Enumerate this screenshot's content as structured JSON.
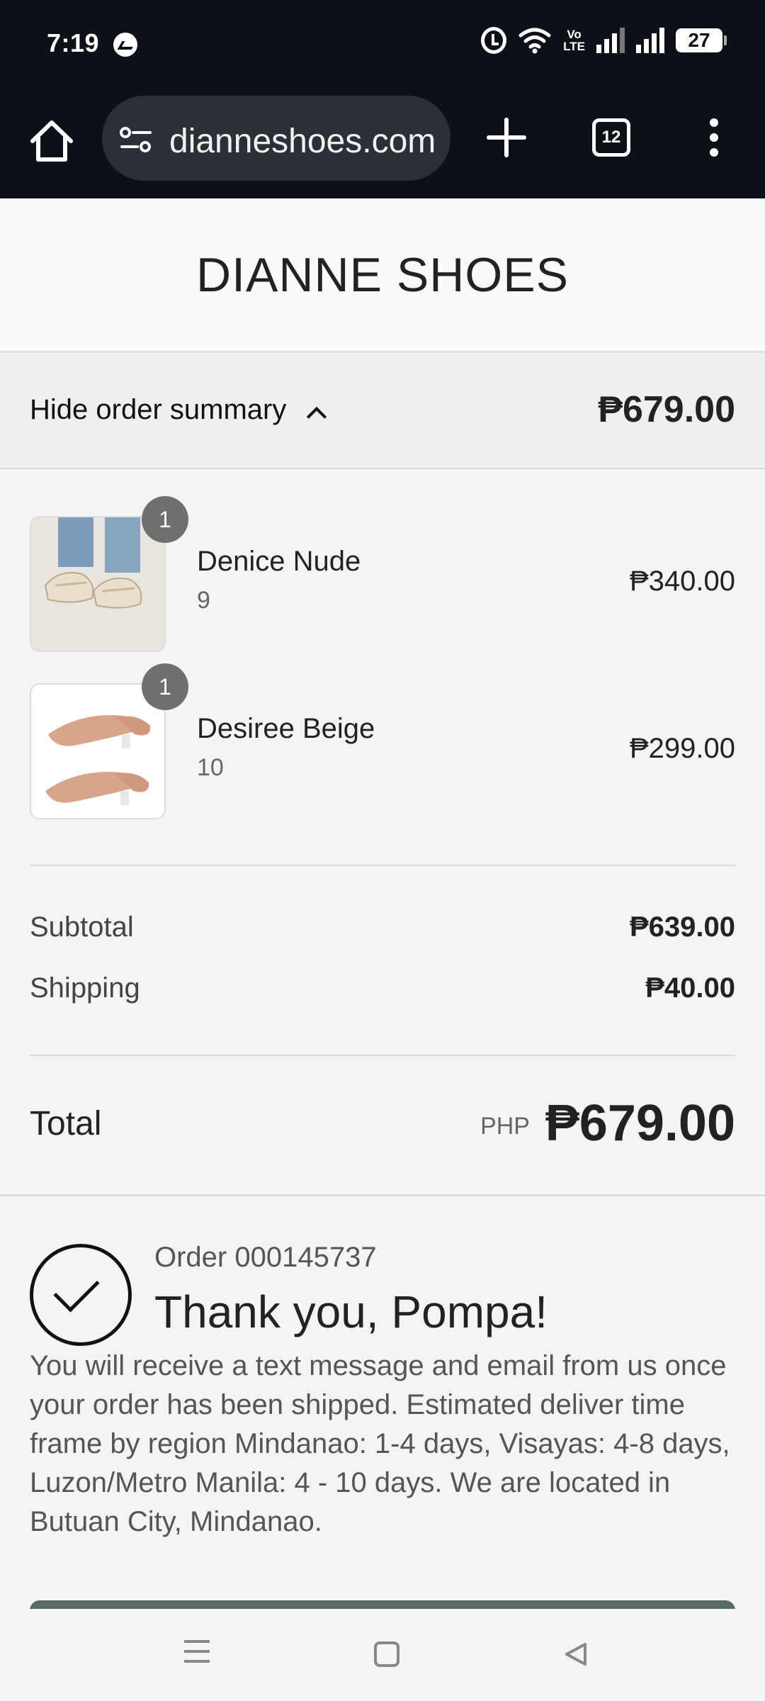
{
  "status_bar": {
    "time": "7:19",
    "battery": "27",
    "volte_top": "Vo",
    "volte_bottom": "LTE"
  },
  "browser": {
    "url": "dianneshoes.com",
    "tab_count": "12"
  },
  "header": {
    "brand": "DIANNE SHOES"
  },
  "summary": {
    "toggle_label": "Hide order summary",
    "total": "₱679.00"
  },
  "items": [
    {
      "name": "Denice Nude",
      "variant": "9",
      "price": "₱340.00",
      "quantity": "1"
    },
    {
      "name": "Desiree Beige",
      "variant": "10",
      "price": "₱299.00",
      "quantity": "1"
    }
  ],
  "totals": {
    "subtotal_label": "Subtotal",
    "subtotal_value": "₱639.00",
    "shipping_label": "Shipping",
    "shipping_value": "₱40.00",
    "total_label": "Total",
    "currency": "PHP",
    "total_value": "₱679.00"
  },
  "confirmation": {
    "order_number": "Order 000145737",
    "thank_you": "Thank you, Pompa!",
    "message": "You will receive a text message and email from us once your order has been shipped. Estimated deliver time frame by region Mindanao: 1-4 days, Visayas: 4-8 days, Luzon/Metro Manila: 4 - 10 days. We are located in Butuan City, Mindanao."
  },
  "colors": {
    "status_bar_bg": "#0d1117",
    "page_bg": "#f4f4f4",
    "badge_bg": "#6f6f6f"
  },
  "icons": {
    "status": [
      "messenger-icon",
      "alarm-icon",
      "wifi-icon",
      "volte-icon",
      "signal-icon",
      "battery-icon"
    ],
    "browser": [
      "home-icon",
      "site-settings-icon",
      "new-tab-icon",
      "tabs-icon",
      "more-options-icon"
    ],
    "nav": [
      "recents-icon",
      "home-icon",
      "back-icon"
    ]
  }
}
